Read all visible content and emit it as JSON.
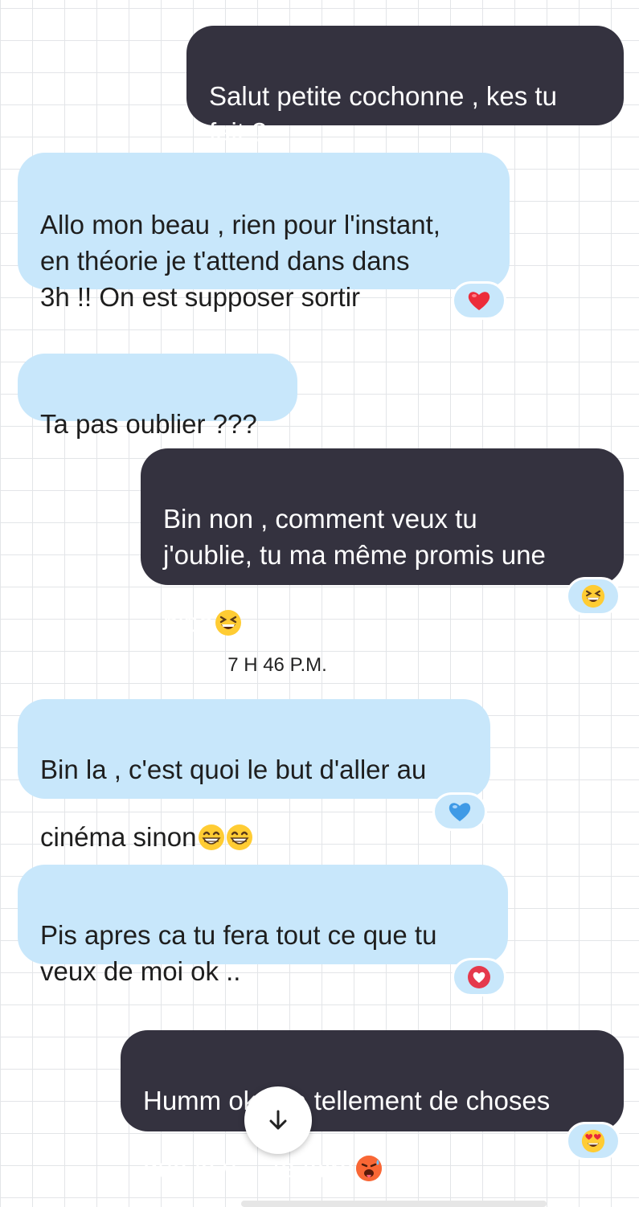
{
  "messages": [
    {
      "side": "sent",
      "text": "Salut petite cochonne , kes tu\nfait ?"
    },
    {
      "side": "received",
      "text": "Allo mon beau , rien pour l'instant,\nen théorie je t'attend dans dans\n3h  !! On est supposer sortir",
      "reaction": "red-heart"
    },
    {
      "side": "received",
      "text": "Ta pas oublier ???"
    },
    {
      "side": "sent",
      "text": "Bin non , comment veux tu\nj'oublie,  tu ma même promis une\npipe",
      "inline_emoji": "grinning-squinting-face",
      "reaction": "grinning-squinting-face"
    },
    {
      "side": "received",
      "text": "Bin la , c'est quoi le but d'aller au\ncinéma sinon",
      "inline_emoji": "beaming-face x2",
      "reaction": "blue-heart"
    },
    {
      "side": "received",
      "text": "Pis apres ca tu fera tout ce que tu\nveux de moi ok ..",
      "reaction": "heart-circle"
    },
    {
      "side": "sent",
      "text": "Humm ok , ya tellement de choses\nque je v",
      "text_after_button": "te faire",
      "inline_emoji": "hot-face",
      "reaction": "heart-eyes-face"
    }
  ],
  "timestamp": "7 H 46 P.M.",
  "scroll_button_icon": "arrow-down-icon",
  "colors": {
    "sent_bubble": "#34323f",
    "received_bubble": "#c8e7fb",
    "grid": "#e3e5e8"
  }
}
